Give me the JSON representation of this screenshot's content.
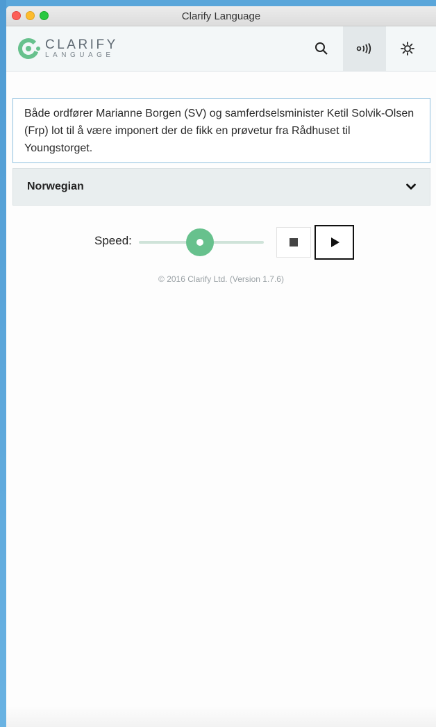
{
  "window": {
    "title": "Clarify Language"
  },
  "app": {
    "logo_main": "CLARIFY",
    "logo_sub": "LANGUAGE",
    "brand_color": "#67c18d",
    "toolbar": {
      "search_icon": "search-icon",
      "speak_icon": "speak-icon",
      "settings_icon": "gear-icon"
    }
  },
  "main": {
    "text": "Både ordfører Marianne Borgen (SV) og samferdselsminister Ketil Solvik-Olsen (Frp) lot til å være imponert der de fikk en prøvetur fra Rådhuset til Youngstorget.",
    "language": "Norwegian",
    "speed_label": "Speed:",
    "copyright": "© 2016 Clarify Ltd. (Version 1.7.6)"
  }
}
